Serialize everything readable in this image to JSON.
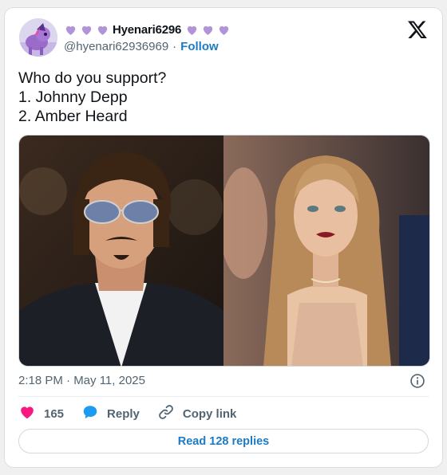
{
  "tweet": {
    "user": {
      "display_name": "Hyenari6296",
      "handle": "@hyenari62936969",
      "separator": "·",
      "follow_label": "Follow",
      "decoration_icon": "purple-heart-icon"
    },
    "text": "Who do you support?\n1. Johnny Depp\n2. Amber Heard",
    "media": [
      {
        "icon": "photo",
        "description_icon": "man-portrait-photo"
      },
      {
        "icon": "photo",
        "description_icon": "woman-portrait-photo"
      }
    ],
    "timestamp": "2:18 PM · May 11, 2025",
    "actions": {
      "like_count": "165",
      "reply_label": "Reply",
      "copy_link_label": "Copy link"
    },
    "read_replies_label": "Read 128 replies"
  },
  "colors": {
    "heart_purple": "#b194d8",
    "like_pink": "#f91880",
    "reply_blue": "#1d9bf0",
    "link_blue": "#1d7bc4"
  }
}
